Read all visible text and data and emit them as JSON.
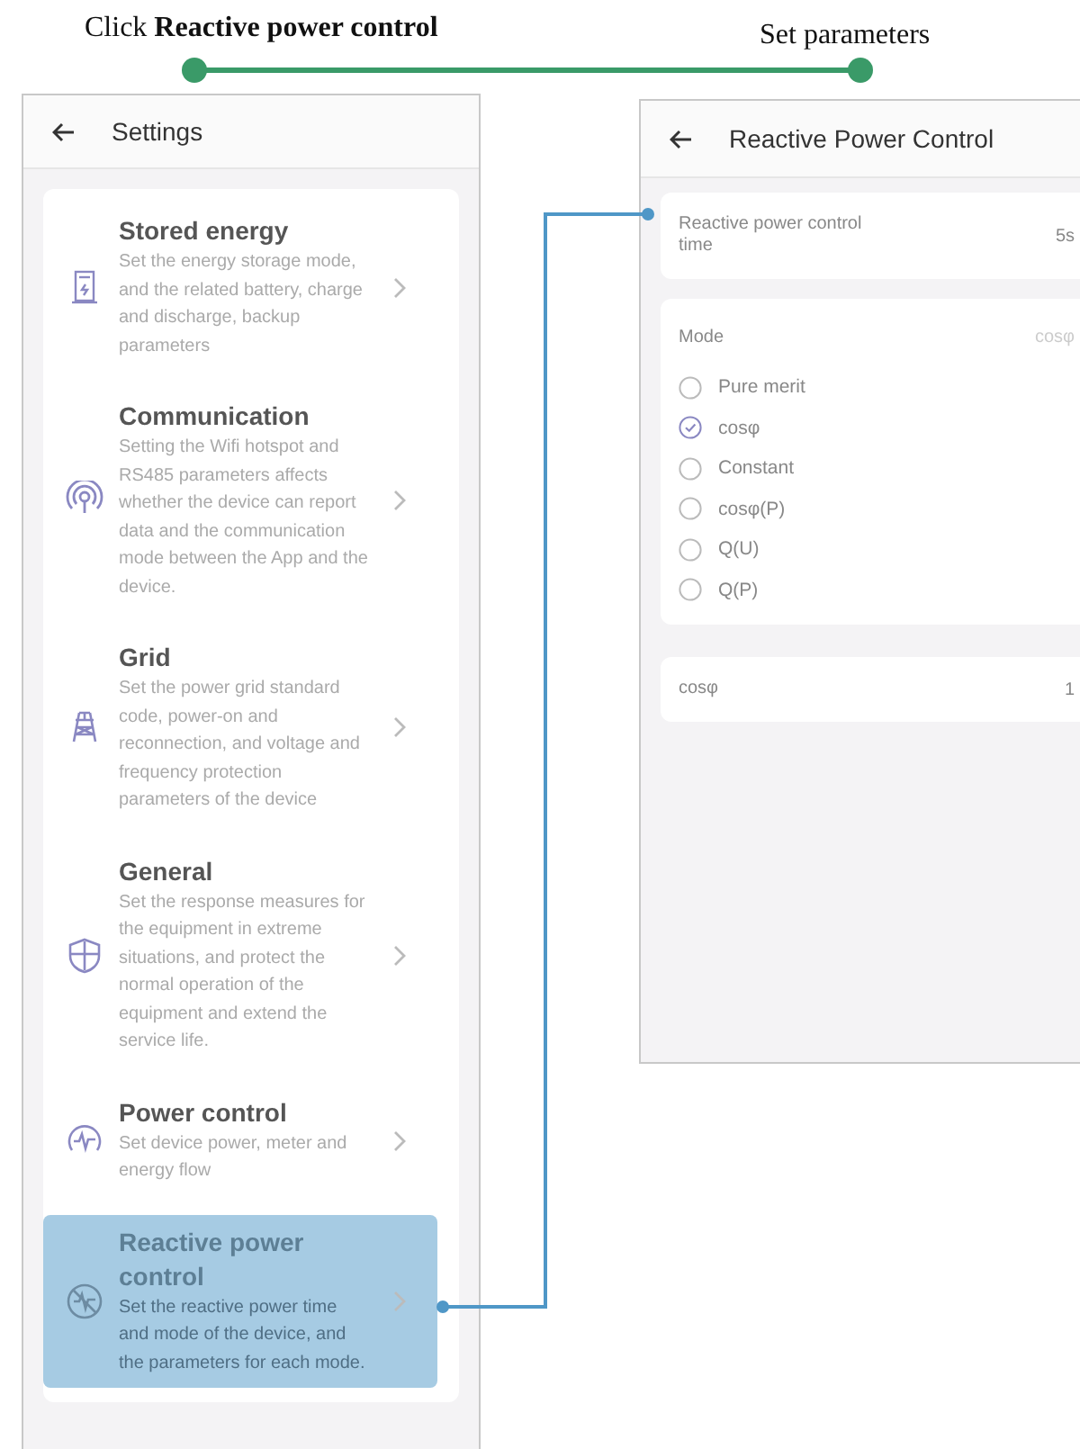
{
  "captions": [
    {
      "text": "Click **Reactive power control**"
    },
    {
      "text": "Set parameters"
    }
  ],
  "settings": {
    "title": "Settings",
    "items": [
      {
        "title": "Stored energy",
        "description": "Set the energy storage mode, and the related battery, charge and discharge, backup parameters",
        "selected": false
      },
      {
        "title": "Communication",
        "description": "Setting the Wifi hotspot and RS485 parameters affects whether the device can report data and the communication mode between the App and the device.",
        "selected": false
      },
      {
        "title": "Grid",
        "description": "Set the power grid standard code, power-on and reconnection, and voltage and frequency protection parameters of the device",
        "selected": false
      },
      {
        "title": "General",
        "description": "Set the response measures for the equipment in extreme situations, and protect the normal operation of the equipment and extend the service life.",
        "selected": false
      },
      {
        "title": "Power control",
        "description": "Set device power, meter and energy flow",
        "selected": false
      },
      {
        "title": "Reactive power control",
        "description": "Set the reactive power time and mode of the device, and the parameters for each mode.",
        "selected": true
      }
    ]
  },
  "reactive": {
    "title": "Reactive Power Control",
    "time": {
      "label": "Reactive power control time",
      "value": "5s"
    },
    "mode": {
      "label": "Mode",
      "value": "cosφ",
      "options": [
        {
          "label": "Pure merit",
          "selected": false
        },
        {
          "label": "cosφ",
          "selected": true
        },
        {
          "label": "Constant",
          "selected": false
        },
        {
          "label": "cosφ(P)",
          "selected": false
        },
        {
          "label": "Q(U)",
          "selected": false
        },
        {
          "label": "Q(P)",
          "selected": false
        }
      ]
    },
    "parameter": {
      "label": "cosφ",
      "value": "1"
    }
  }
}
